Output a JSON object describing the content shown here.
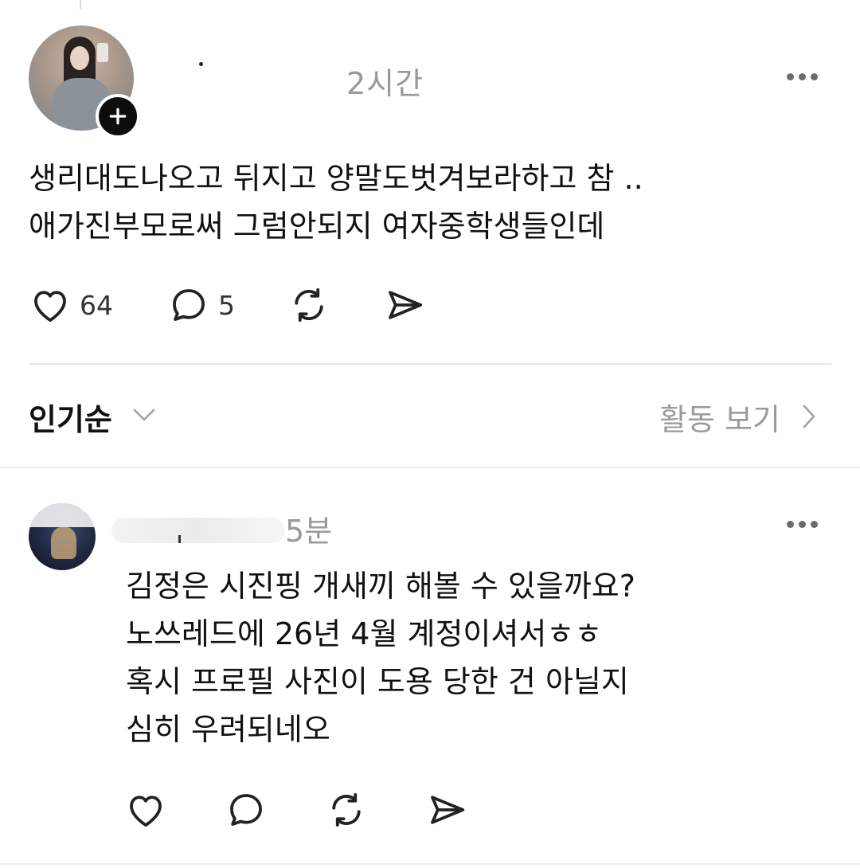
{
  "post": {
    "timestamp": "2시간",
    "text": "생리대도나오고 뒤지고 양말도벗겨보라하고 참 ..\n애가진부모로써 그럼안되지 여자중학생들인데",
    "likes": "64",
    "replies": "5",
    "icons": [
      "heart-icon",
      "comment-icon",
      "repost-icon",
      "share-icon",
      "more-icon",
      "plus-icon"
    ]
  },
  "sort": {
    "label": "인기순",
    "activity_label": "활동 보기"
  },
  "comment": {
    "timestamp": "5분",
    "text": "김정은 시진핑 개새끼 해볼 수 있을까요?\n노쓰레드에 26년 4월 계정이셔서ㅎㅎ\n혹시 프로필 사진이 도용 당한 건 아닐지\n심히 우려되네오"
  }
}
